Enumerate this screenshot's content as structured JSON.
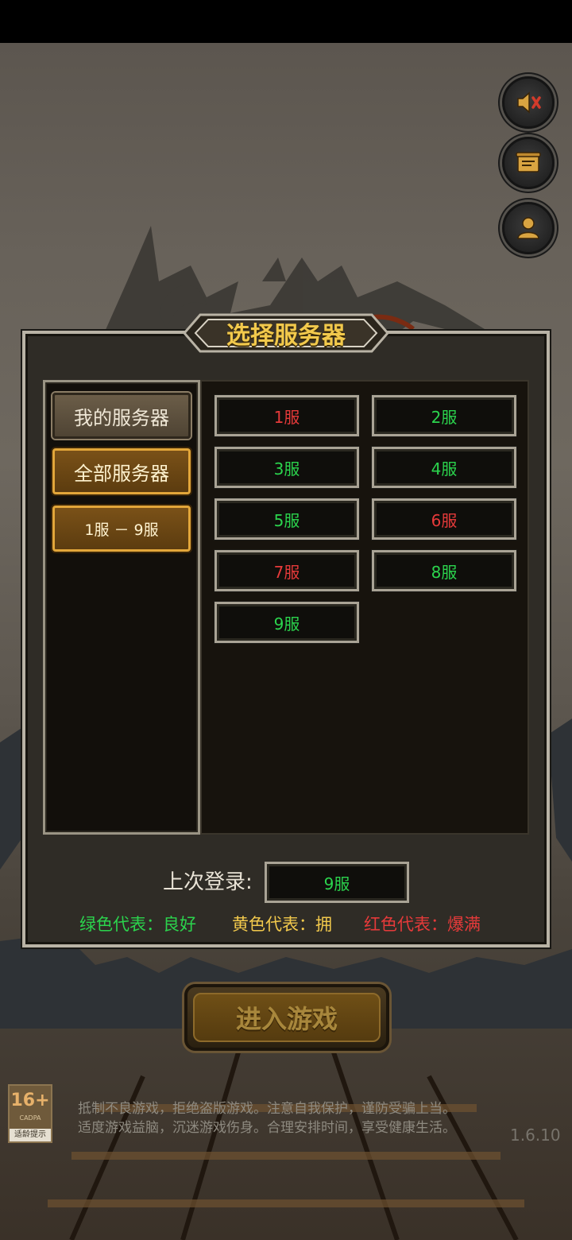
{
  "header": {
    "title": "选择服务器"
  },
  "controls": {
    "sound_icon": "speaker-muted-icon",
    "notice_icon": "scroll-icon",
    "account_icon": "user-icon"
  },
  "tabs": [
    {
      "label": "我的服务器"
    },
    {
      "label": "全部服务器"
    },
    {
      "label": "1服 － 9服"
    }
  ],
  "servers": [
    {
      "label": "1服",
      "status": "red"
    },
    {
      "label": "2服",
      "status": "green"
    },
    {
      "label": "3服",
      "status": "green"
    },
    {
      "label": "4服",
      "status": "green"
    },
    {
      "label": "5服",
      "status": "green"
    },
    {
      "label": "6服",
      "status": "red"
    },
    {
      "label": "7服",
      "status": "red"
    },
    {
      "label": "8服",
      "status": "green"
    },
    {
      "label": "9服",
      "status": "green"
    }
  ],
  "last_login": {
    "label": "上次登录:",
    "value": "9服"
  },
  "legend": {
    "green": "绿色代表：良好",
    "yellow": "黄色代表：拥",
    "red": "红色代表：爆满"
  },
  "enter_button": {
    "label": "进入游戏"
  },
  "age_rating": {
    "number": "16+",
    "org": "CADPA",
    "tag": "适龄提示"
  },
  "notice": {
    "line1": "抵制不良游戏，拒绝盗版游戏。注意自我保护，谨防受骗上当。",
    "line2": "适度游戏益脑，沉迷游戏伤身。合理安排时间，享受健康生活。"
  },
  "version": "1.6.10",
  "colors": {
    "good": "#2bd44d",
    "busy": "#f2c94c",
    "full": "#e63a3a",
    "title": "#f2c94c"
  }
}
